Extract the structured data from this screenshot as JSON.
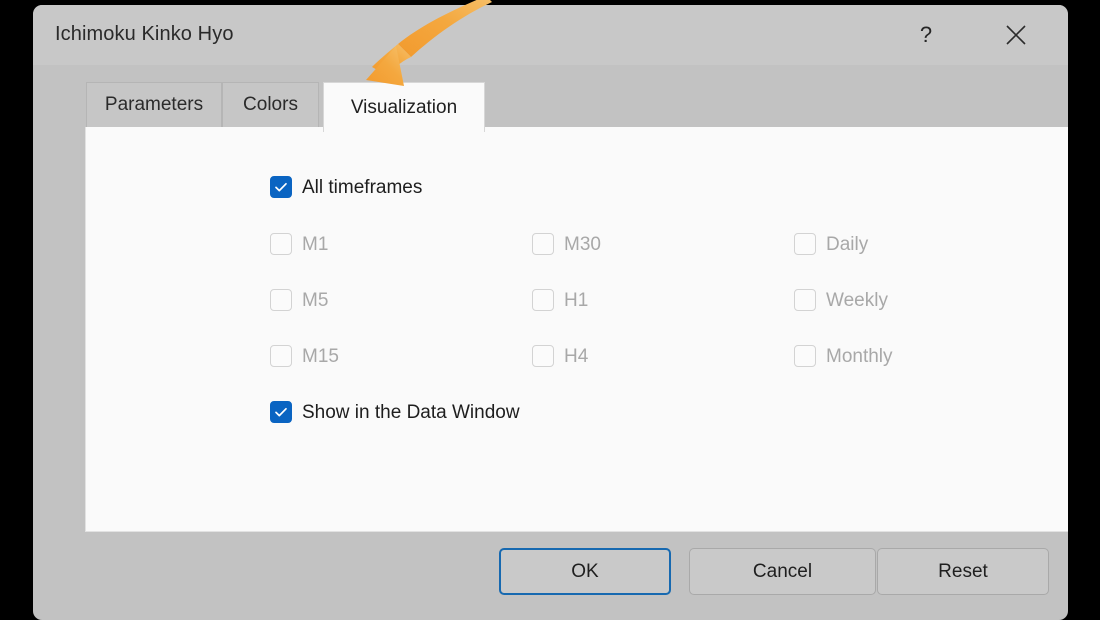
{
  "window": {
    "title": "Ichimoku Kinko Hyo",
    "help_icon": "question-mark-icon",
    "close_icon": "close-icon"
  },
  "tabs": [
    {
      "label": "Parameters",
      "active": false
    },
    {
      "label": "Colors",
      "active": false
    },
    {
      "label": "Visualization",
      "active": true
    }
  ],
  "visualization": {
    "all_timeframes": {
      "label": "All timeframes",
      "checked": true,
      "enabled": true
    },
    "timeframes": [
      {
        "label": "M1",
        "checked": false,
        "enabled": false
      },
      {
        "label": "M5",
        "checked": false,
        "enabled": false
      },
      {
        "label": "M15",
        "checked": false,
        "enabled": false
      },
      {
        "label": "M30",
        "checked": false,
        "enabled": false
      },
      {
        "label": "H1",
        "checked": false,
        "enabled": false
      },
      {
        "label": "H4",
        "checked": false,
        "enabled": false
      },
      {
        "label": "Daily",
        "checked": false,
        "enabled": false
      },
      {
        "label": "Weekly",
        "checked": false,
        "enabled": false
      },
      {
        "label": "Monthly",
        "checked": false,
        "enabled": false
      }
    ],
    "show_in_data_window": {
      "label": "Show in the Data Window",
      "checked": true,
      "enabled": true
    }
  },
  "footer": {
    "ok_label": "OK",
    "cancel_label": "Cancel",
    "reset_label": "Reset"
  },
  "annotation": {
    "arrow_icon": "curved-arrow-icon",
    "arrow_color": "#f2a33c",
    "points_to": "Visualization"
  },
  "colors": {
    "dialog_background": "#c2c2c2",
    "titlebar_background": "#c8c8c8",
    "panel_background": "#fafafa",
    "checkbox_checked": "#0a64c2",
    "checkbox_unchecked_border": "#d3d3d3",
    "primary_button_border": "#1769b0",
    "disabled_text": "#a8a8a8",
    "text": "#1e1e1e",
    "page_background": "#000000"
  }
}
